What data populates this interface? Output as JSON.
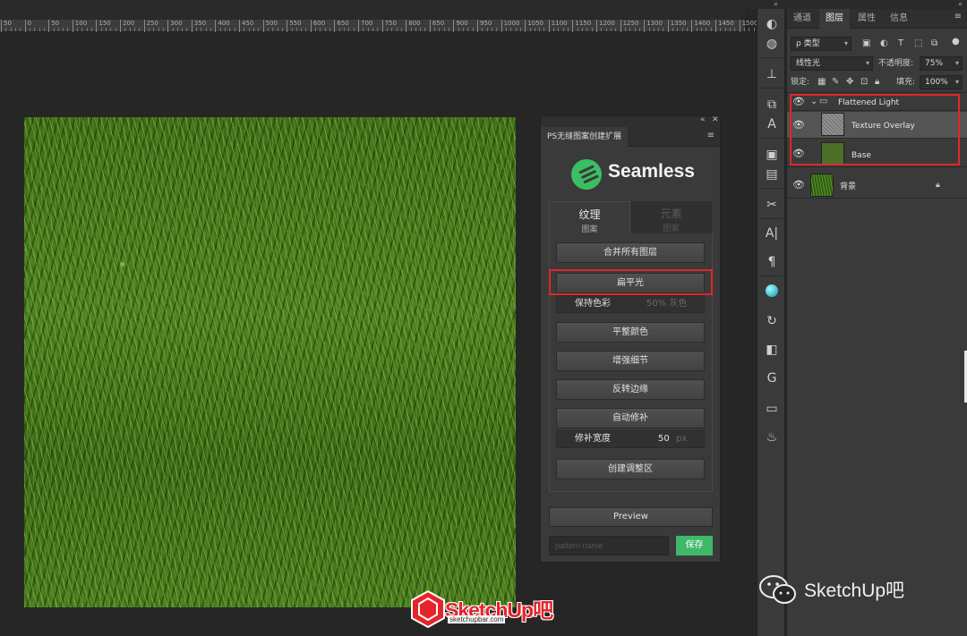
{
  "ruler": {
    "labels": [
      "50",
      "0",
      "50",
      "100",
      "150",
      "200",
      "250",
      "300",
      "350",
      "400",
      "450",
      "500",
      "550",
      "600",
      "650",
      "700",
      "750",
      "800",
      "850",
      "900",
      "950",
      "1000",
      "1050",
      "1100",
      "1150",
      "1200",
      "1250",
      "1300",
      "1350",
      "1400",
      "1450",
      "1500"
    ]
  },
  "extension": {
    "tab_title": "PS无缝图案创建扩展",
    "brand": "Seamless",
    "tabs": [
      {
        "main": "纹理",
        "sub": "图案"
      },
      {
        "main": "元素",
        "sub": "图案"
      }
    ],
    "buttons": {
      "merge_all": "合并所有图层",
      "flatten_light": "扁平光",
      "even_color": "平整颜色",
      "enhance_detail": "增强细节",
      "flip_edges": "反转边缘",
      "auto_patch": "自动修补",
      "create_adjust": "创建调整区"
    },
    "keep_color_row": {
      "left": "保持色彩",
      "right": "50% 灰色"
    },
    "patch_width_row": {
      "label": "修补宽度",
      "value": "50",
      "unit": "px"
    },
    "preview": "Preview",
    "pattern_placeholder": "pattern name",
    "save": "保存",
    "accent": "#3fb86a"
  },
  "layers_panel": {
    "tabs": [
      "通道",
      "图层",
      "属性",
      "信息"
    ],
    "filter_kind": "ρ 类型",
    "blend_mode": "线性光",
    "opacity_label": "不透明度:",
    "opacity_value": "75%",
    "lock_label": "锁定:",
    "fill_label": "填充:",
    "fill_value": "100%",
    "layers": [
      {
        "name": "Flattened Light"
      },
      {
        "name": "Texture Overlay"
      },
      {
        "name": "Base"
      },
      {
        "name": "背景"
      }
    ]
  },
  "watermark": {
    "brand_main": "SketchUp吧",
    "brand_sub": "sketchupbar.com",
    "wechat": "SketchUp吧"
  }
}
